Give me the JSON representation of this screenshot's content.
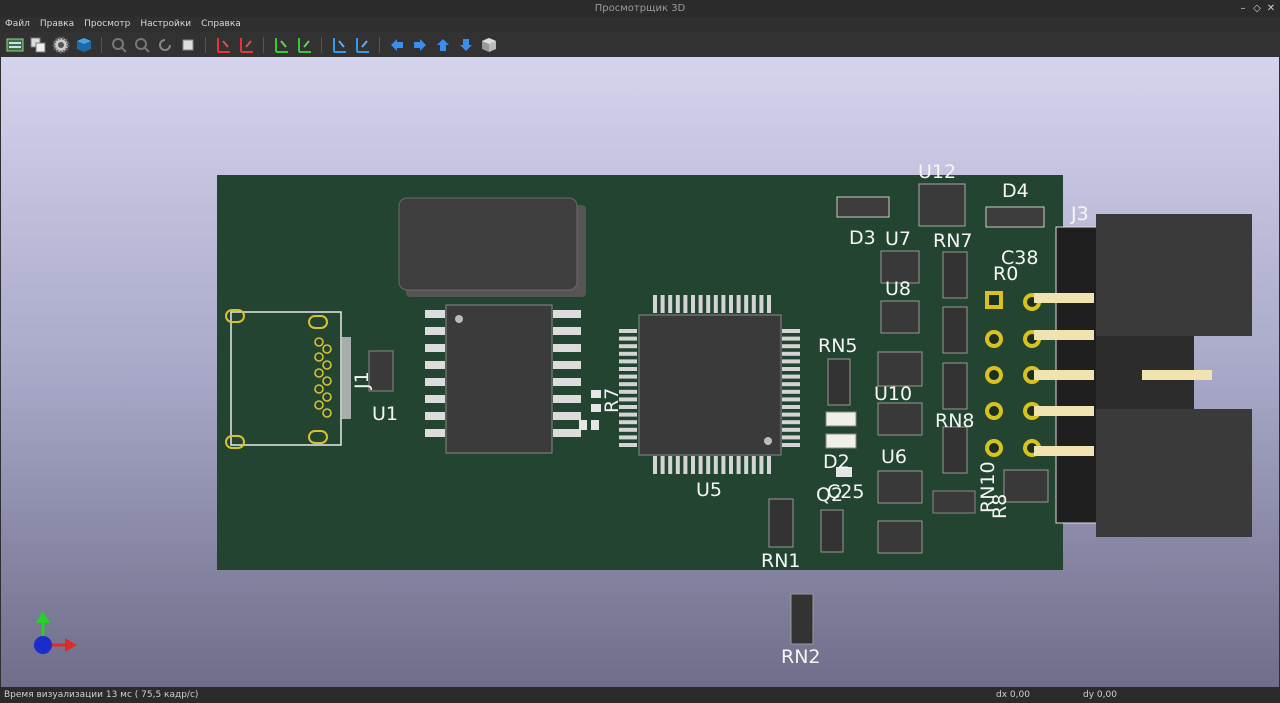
{
  "window": {
    "title": "Просмотрщик 3D"
  },
  "menu": [
    {
      "label": "Файл"
    },
    {
      "label": "Правка"
    },
    {
      "label": "Просмотр"
    },
    {
      "label": "Настройки"
    },
    {
      "label": "Справка"
    }
  ],
  "toolbar_icons": [
    "reload-board-icon",
    "copy-image-icon",
    "settings-gear-icon",
    "raytracing-cube-icon",
    "zoom-in-icon",
    "zoom-out-icon",
    "redraw-icon",
    "zoom-fit-icon",
    "rotate-x-cw-icon",
    "rotate-x-ccw-icon",
    "rotate-y-cw-icon",
    "rotate-y-ccw-icon",
    "rotate-z-cw-icon",
    "rotate-z-ccw-icon",
    "pan-left-icon",
    "pan-right-icon",
    "pan-up-icon",
    "pan-down-icon",
    "ortho-view-icon"
  ],
  "board": {
    "labels": {
      "u12": "U12",
      "d4": "D4",
      "j3": "J3",
      "d3": "D3",
      "u7": "U7",
      "rn7": "RN7",
      "c38": "C38",
      "r0": "R0",
      "u8": "U8",
      "rn5": "RN5",
      "u10": "U10",
      "rn8": "RN8",
      "u1": "U1",
      "j1": "J1",
      "r7": "R7",
      "u5": "U5",
      "d2": "D2",
      "u6": "U6",
      "c25": "C25",
      "q2": "Q2",
      "rn10": "RN10",
      "r8": "R8",
      "rn1": "RN1",
      "rn2": "RN2"
    }
  },
  "status": {
    "message": "Время визуализации 13 мс ( 75,5 кадр/с)",
    "dx": "dx 0,00",
    "dy": "dy 0,00"
  }
}
